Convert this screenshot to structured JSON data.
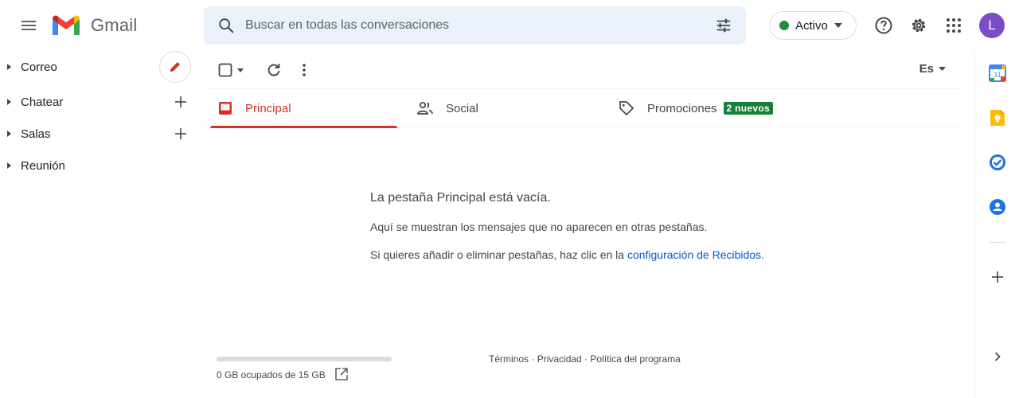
{
  "header": {
    "app_name": "Gmail",
    "search_placeholder": "Buscar en todas las conversaciones",
    "status_label": "Activo",
    "status_color": "#1e8e3e",
    "avatar_letter": "L",
    "icons": [
      "menu-icon",
      "gmail-logo",
      "search-icon",
      "filter-options-icon",
      "help-icon",
      "settings-icon",
      "apps-icon"
    ]
  },
  "nav": {
    "items": [
      {
        "label": "Correo"
      },
      {
        "label": "Chatear"
      },
      {
        "label": "Salas"
      },
      {
        "label": "Reunión"
      }
    ]
  },
  "toolbar": {
    "language": "Es"
  },
  "tabs": [
    {
      "label": "Principal",
      "active": true
    },
    {
      "label": "Social",
      "active": false
    },
    {
      "label": "Promociones",
      "active": false,
      "badge": "2 nuevos"
    }
  ],
  "empty_state": {
    "title": "La pestaña Principal está vacía.",
    "line1": "Aquí se muestran los mensajes que no aparecen en otras pestañas.",
    "line2_prefix": "Si quieres añadir o eliminar pestañas, haz clic en la ",
    "line2_link": "configuración de Recibidos",
    "line2_suffix": "."
  },
  "footer": {
    "storage": "0 GB ocupados de 15 GB",
    "storage_used_fraction": 0,
    "links": {
      "terms": "Términos",
      "privacy": "Privacidad",
      "policy": "Política del programa",
      "separator": " · "
    }
  },
  "side_panel": {
    "calendar_day": "31",
    "icons": [
      "calendar-icon",
      "keep-icon",
      "tasks-icon",
      "contacts-icon",
      "add-icon",
      "expand-icon"
    ]
  },
  "colors": {
    "accent_red": "#d93025",
    "badge_green": "#188038",
    "link_blue": "#0b57d0",
    "search_bg": "#eaf1fb",
    "avatar_bg": "#7b4cc7"
  }
}
